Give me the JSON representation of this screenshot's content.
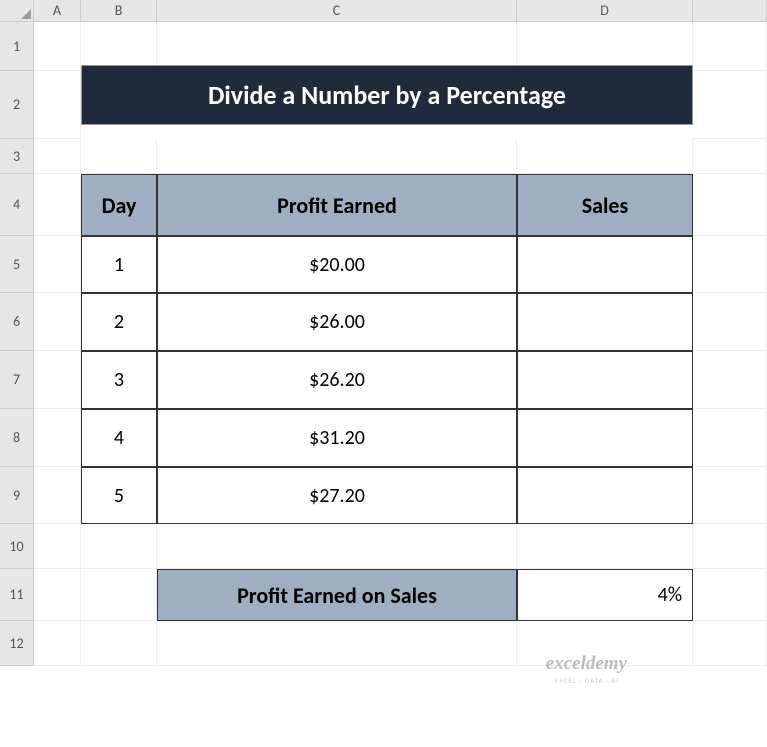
{
  "columns": [
    "A",
    "B",
    "C",
    "D"
  ],
  "rows": [
    "1",
    "2",
    "3",
    "4",
    "5",
    "6",
    "7",
    "8",
    "9",
    "10",
    "11",
    "12"
  ],
  "title": "Divide a Number by a Percentage",
  "tableHeaders": {
    "day": "Day",
    "profit": "Profit Earned",
    "sales": "Sales"
  },
  "data": [
    {
      "day": "1",
      "profit": "$20.00",
      "sales": ""
    },
    {
      "day": "2",
      "profit": "$26.00",
      "sales": ""
    },
    {
      "day": "3",
      "profit": "$26.20",
      "sales": ""
    },
    {
      "day": "4",
      "profit": "$31.20",
      "sales": ""
    },
    {
      "day": "5",
      "profit": "$27.20",
      "sales": ""
    }
  ],
  "profitOnSales": {
    "label": "Profit Earned on Sales",
    "value": "4%"
  },
  "watermark": "exceldemy",
  "watermarkSub": "EXCEL · DATA · BI"
}
